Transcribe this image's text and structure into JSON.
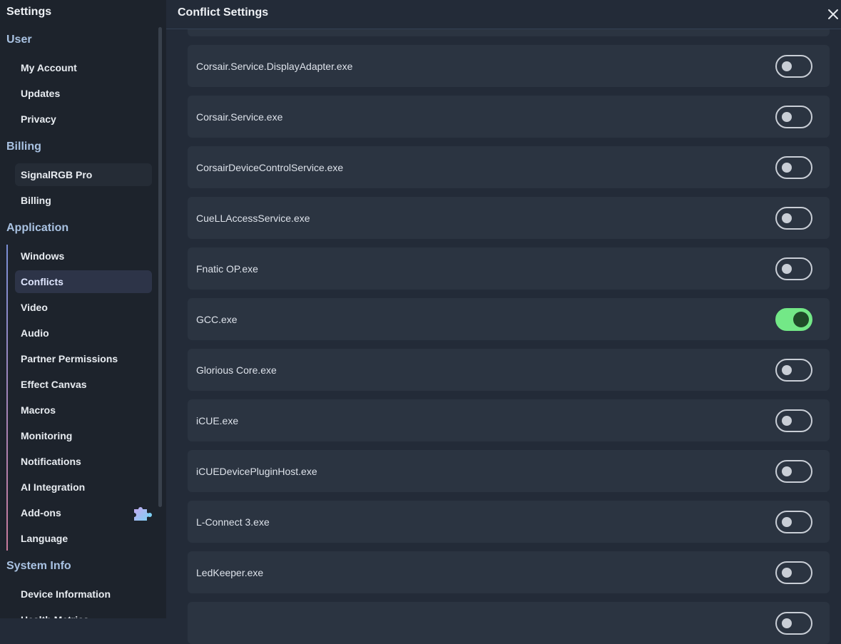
{
  "sidebar": {
    "title": "Settings",
    "sections": {
      "user": "User",
      "billing": "Billing",
      "application": "Application",
      "system_info": "System Info"
    },
    "items": {
      "my_account": "My Account",
      "updates": "Updates",
      "privacy": "Privacy",
      "signalrgb_pro": "SignalRGB Pro",
      "billing": "Billing",
      "windows": "Windows",
      "conflicts": "Conflicts",
      "video": "Video",
      "audio": "Audio",
      "partner_permissions": "Partner Permissions",
      "effect_canvas": "Effect Canvas",
      "macros": "Macros",
      "monitoring": "Monitoring",
      "notifications": "Notifications",
      "ai_integration": "AI Integration",
      "add_ons": "Add-ons",
      "language": "Language",
      "device_information": "Device Information",
      "health_metrics": "Health Metrics"
    },
    "active_item": "Conflicts"
  },
  "header": {
    "title": "Conflict Settings",
    "close_label": "×"
  },
  "conflicts": [
    {
      "name": "Corsair.Service.DisplayAdapter.exe",
      "enabled": false
    },
    {
      "name": "Corsair.Service.exe",
      "enabled": false
    },
    {
      "name": "CorsairDeviceControlService.exe",
      "enabled": false
    },
    {
      "name": "CueLLAccessService.exe",
      "enabled": false
    },
    {
      "name": "Fnatic OP.exe",
      "enabled": false
    },
    {
      "name": "GCC.exe",
      "enabled": true
    },
    {
      "name": "Glorious Core.exe",
      "enabled": false
    },
    {
      "name": "iCUE.exe",
      "enabled": false
    },
    {
      "name": "iCUEDevicePluginHost.exe",
      "enabled": false
    },
    {
      "name": "L-Connect 3.exe",
      "enabled": false
    },
    {
      "name": "LedKeeper.exe",
      "enabled": false
    },
    {
      "name": "",
      "enabled": false
    }
  ],
  "colors": {
    "accent_toggle_on": "#73e887",
    "section_heading": "#a9c2e2"
  }
}
